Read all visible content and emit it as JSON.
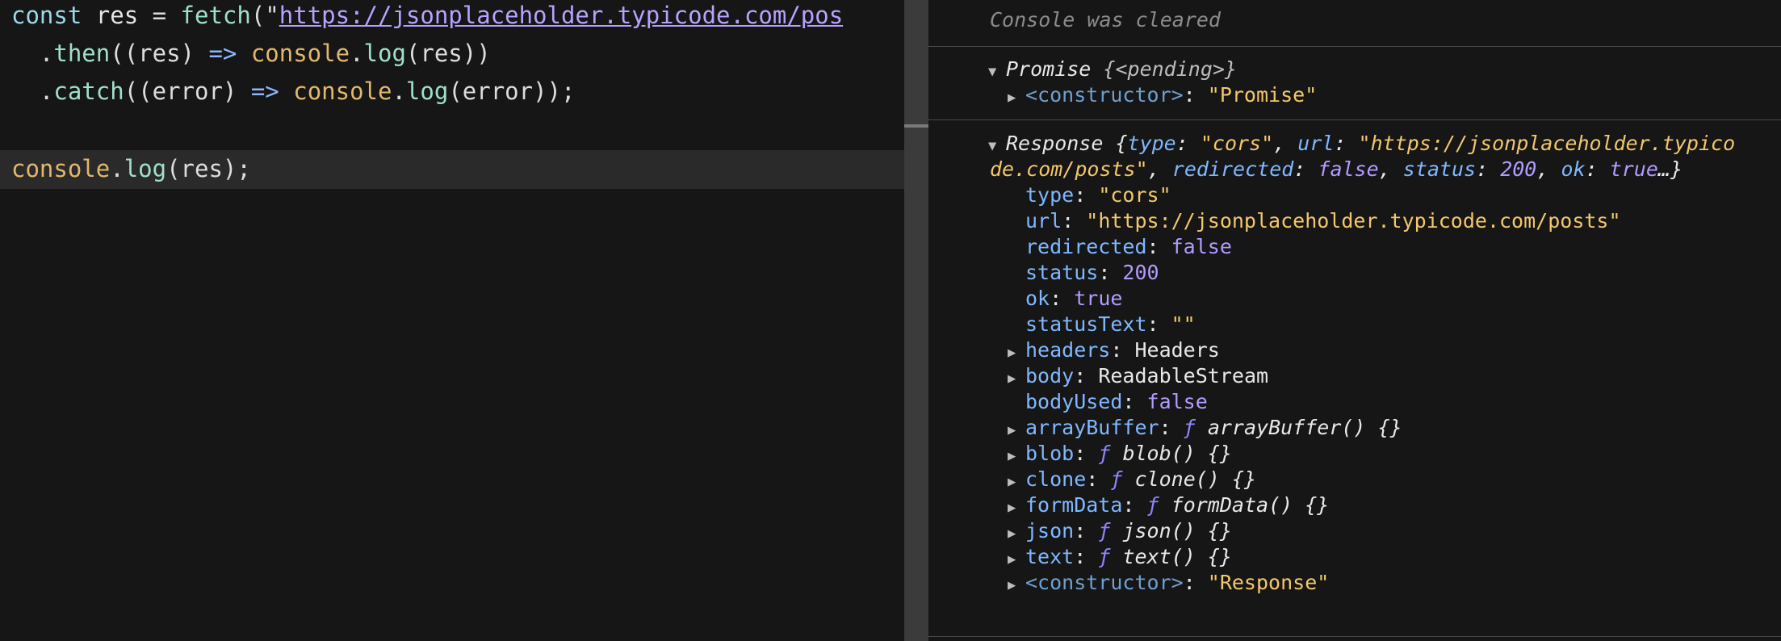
{
  "editor": {
    "line1": {
      "kw_const": "const",
      "var_res": " res ",
      "eq": "= ",
      "fn_fetch": "fetch",
      "open": "(\"",
      "url": "https://jsonplaceholder.typicode.com/pos"
    },
    "line2": {
      "indent": "  .",
      "then": "then",
      "open": "((res) ",
      "arrow": "=>",
      "space": " ",
      "console": "console",
      "dot": ".",
      "log": "log",
      "args": "(res))"
    },
    "line3": {
      "indent": "  .",
      "catch": "catch",
      "open": "((error) ",
      "arrow": "=>",
      "space": " ",
      "console": "console",
      "dot": ".",
      "log": "log",
      "args": "(error));"
    },
    "line5": {
      "console": "console",
      "dot": ".",
      "log": "log",
      "args": "(res);"
    }
  },
  "console": {
    "cleared_text": "Console was cleared",
    "promise": {
      "head_name": "Promise ",
      "head_state": "{<pending>}",
      "constructor_key": "<constructor>",
      "constructor_val": "\"Promise\""
    },
    "response": {
      "head1": {
        "name": "Response {",
        "k_type": "type",
        "v_type": "\"cors\"",
        "k_url": "url",
        "v_url_a": "\"https://jsonplaceholder.typico"
      },
      "head2": {
        "v_url_b": "de.com/posts\"",
        "k_redirected": "redirected",
        "v_redirected": "false",
        "k_status": "status",
        "v_status": "200",
        "k_ok": "ok",
        "v_ok": "true",
        "tail": "…}"
      },
      "props": {
        "type_k": "type",
        "type_v": "\"cors\"",
        "url_k": "url",
        "url_v": "\"https://jsonplaceholder.typicode.com/posts\"",
        "redirected_k": "redirected",
        "redirected_v": "false",
        "status_k": "status",
        "status_v": "200",
        "ok_k": "ok",
        "ok_v": "true",
        "statusText_k": "statusText",
        "statusText_v": "\"\"",
        "headers_k": "headers",
        "headers_v": "Headers",
        "body_k": "body",
        "body_v": "ReadableStream",
        "bodyUsed_k": "bodyUsed",
        "bodyUsed_v": "false",
        "arrayBuffer_k": "arrayBuffer",
        "arrayBuffer_v": "arrayBuffer() {}",
        "blob_k": "blob",
        "blob_v": "blob() {}",
        "clone_k": "clone",
        "clone_v": "clone() {}",
        "formData_k": "formData",
        "formData_v": "formData() {}",
        "json_k": "json",
        "json_v": "json() {}",
        "text_k": "text",
        "text_v": "text() {}",
        "constructor_k": "<constructor>",
        "constructor_v": "\"Response\""
      },
      "f_symbol": "ƒ"
    }
  },
  "colors": {
    "background": "#161616",
    "string": "#f3c86a",
    "keyword": "#9dd8e8",
    "property": "#7fb8ff",
    "number_bool": "#b39bff"
  }
}
